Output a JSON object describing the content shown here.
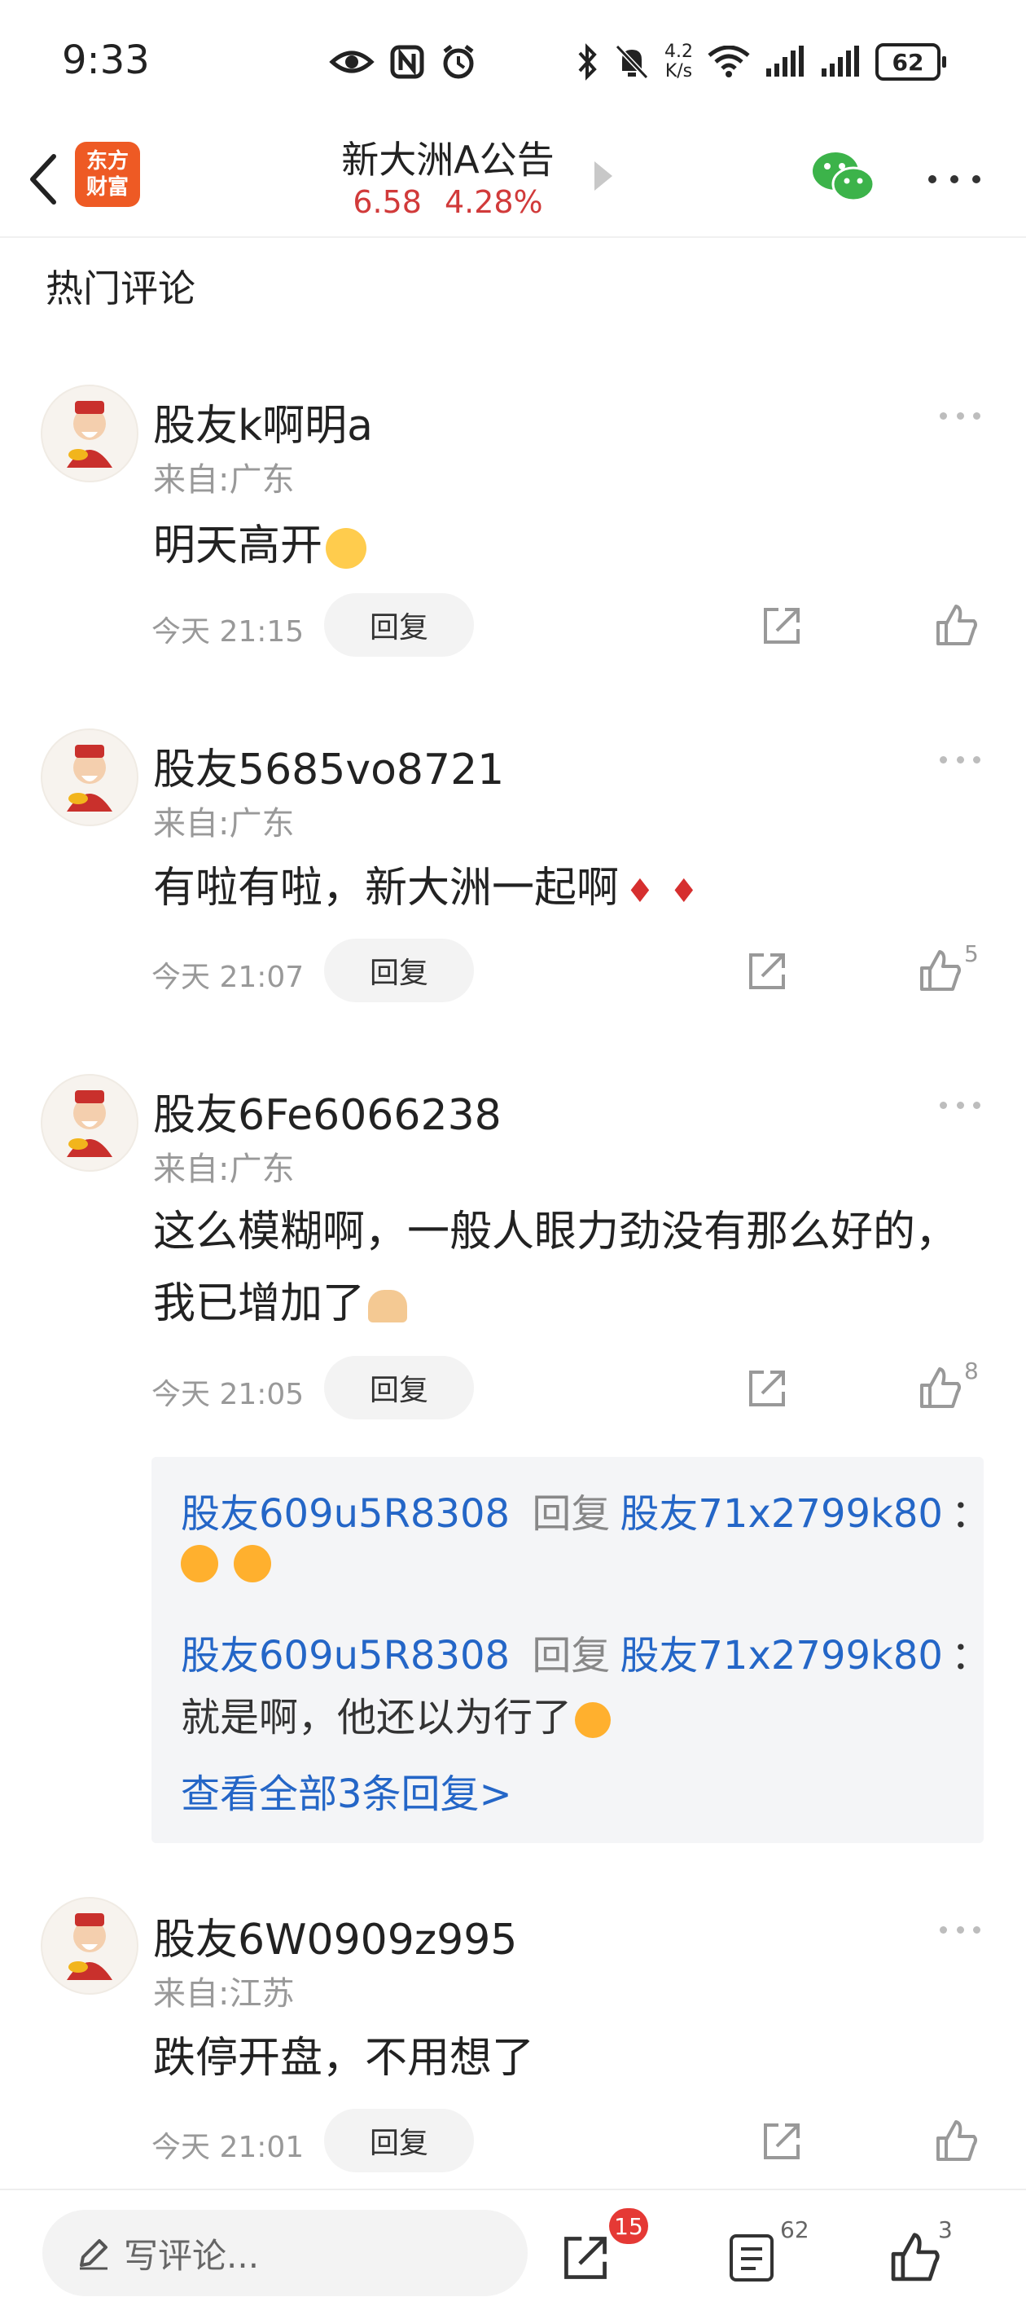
{
  "status_bar": {
    "time": "9:33",
    "net_speed_value": "4.2",
    "net_speed_unit": "K/s",
    "battery": "62"
  },
  "nav": {
    "brand_line1": "东方",
    "brand_line2": "财富",
    "title": "新大洲A公告",
    "price": "6.58",
    "change": "4.28%"
  },
  "section_title": "热门评论",
  "comments": [
    {
      "user": "股友k啊明a",
      "location": "来自:广东",
      "text": "明天高开",
      "time": "今天 21:15",
      "reply_label": "回复",
      "likes": ""
    },
    {
      "user": "股友5685vo8721",
      "location": "来自:广东",
      "text": "有啦有啦，新大洲一起啊",
      "time": "今天 21:07",
      "reply_label": "回复",
      "likes": "5"
    },
    {
      "user": "股友6Fe6066238",
      "location": "来自:广东",
      "text": "这么模糊啊，一般人眼力劲没有那么好的，我已增加了",
      "time": "今天 21:05",
      "reply_label": "回复",
      "likes": "8"
    },
    {
      "user": "股友6W0909z995",
      "location": "来自:江苏",
      "text": "跌停开盘，不用想了",
      "time": "今天 21:01",
      "reply_label": "回复",
      "likes": ""
    }
  ],
  "sub_replies": [
    {
      "from": "股友609u5R8308",
      "verb": "回复",
      "to": "股友71x2799k80",
      "colon": "：",
      "text": ""
    },
    {
      "from": "股友609u5R8308",
      "verb": "回复",
      "to": "股友71x2799k80",
      "colon": "：",
      "text": "就是啊，他还以为行了"
    }
  ],
  "view_all_replies": "查看全部3条回复>",
  "bottom_bar": {
    "placeholder": "写评论...",
    "share_badge": "15",
    "comments_count": "62",
    "likes_count": "3"
  }
}
